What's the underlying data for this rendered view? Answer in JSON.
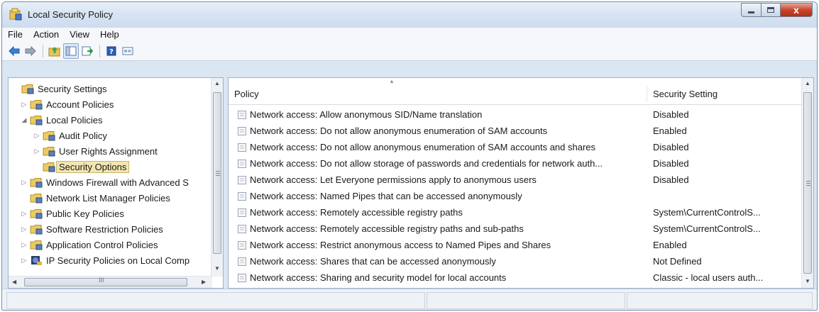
{
  "window": {
    "title": "Local Security Policy",
    "caption_close_glyph": "x"
  },
  "menu": [
    {
      "label": "File"
    },
    {
      "label": "Action"
    },
    {
      "label": "View"
    },
    {
      "label": "Help"
    }
  ],
  "toolbar": {
    "buttons": [
      "back-icon",
      "forward-icon",
      "up-icon",
      "show-hide-tree-icon",
      "export-list-icon",
      "help-icon",
      "properties-icon"
    ]
  },
  "tree": {
    "items": [
      {
        "label": "Security Settings",
        "expander": "",
        "level": 0
      },
      {
        "label": "Account Policies",
        "expander": "▷",
        "level": 1
      },
      {
        "label": "Local Policies",
        "expander": "◢",
        "level": 1
      },
      {
        "label": "Audit Policy",
        "expander": "▷",
        "level": 2
      },
      {
        "label": "User Rights Assignment",
        "expander": "▷",
        "level": 2
      },
      {
        "label": "Security Options",
        "expander": "",
        "level": 2,
        "selected": true
      },
      {
        "label": "Windows Firewall with Advanced S",
        "expander": "▷",
        "level": 1
      },
      {
        "label": "Network List Manager Policies",
        "expander": "",
        "level": 1
      },
      {
        "label": "Public Key Policies",
        "expander": "▷",
        "level": 1
      },
      {
        "label": "Software Restriction Policies",
        "expander": "▷",
        "level": 1
      },
      {
        "label": "Application Control Policies",
        "expander": "▷",
        "level": 1
      },
      {
        "label": "IP Security Policies on Local Comp",
        "expander": "▷",
        "level": 1
      }
    ],
    "hscroll_glyph": "III"
  },
  "list": {
    "columns": {
      "policy": "Policy",
      "setting": "Security Setting"
    },
    "rows": [
      {
        "policy": "Network access: Allow anonymous SID/Name translation",
        "setting": "Disabled"
      },
      {
        "policy": "Network access: Do not allow anonymous enumeration of SAM accounts",
        "setting": "Enabled"
      },
      {
        "policy": "Network access: Do not allow anonymous enumeration of SAM accounts and shares",
        "setting": "Disabled"
      },
      {
        "policy": "Network access: Do not allow storage of passwords and credentials for network auth...",
        "setting": "Disabled"
      },
      {
        "policy": "Network access: Let Everyone permissions apply to anonymous users",
        "setting": "Disabled"
      },
      {
        "policy": "Network access: Named Pipes that can be accessed anonymously",
        "setting": ""
      },
      {
        "policy": "Network access: Remotely accessible registry paths",
        "setting": "System\\CurrentControlS..."
      },
      {
        "policy": "Network access: Remotely accessible registry paths and sub-paths",
        "setting": "System\\CurrentControlS..."
      },
      {
        "policy": "Network access: Restrict anonymous access to Named Pipes and Shares",
        "setting": "Enabled"
      },
      {
        "policy": "Network access: Shares that can be accessed anonymously",
        "setting": "Not Defined"
      },
      {
        "policy": "Network access: Sharing and security model for local accounts",
        "setting": "Classic - local users auth..."
      }
    ]
  },
  "colors": {
    "frame": "#dbe6f3",
    "selection": "#f2e6b0",
    "close_button": "#c8462c"
  }
}
